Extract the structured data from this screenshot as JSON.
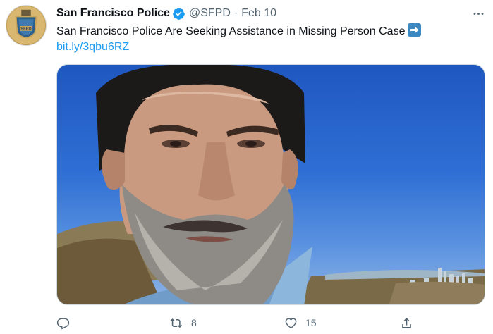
{
  "tweet": {
    "author": {
      "display_name": "San Francisco Police",
      "handle": "@SFPD",
      "verified": true,
      "avatar_icon": "sfpd-badge-avatar"
    },
    "separator": "·",
    "date": "Feb 10",
    "text": "San Francisco Police Are Seeking Assistance in Missing Person Case",
    "emoji": "right-arrow-emoji",
    "link": "bit.ly/3qbu6RZ",
    "media_description_icon": "photo-of-bearded-man"
  },
  "actions": {
    "reply": {
      "icon": "reply-icon",
      "count": ""
    },
    "retweet": {
      "icon": "retweet-icon",
      "count": "8"
    },
    "like": {
      "icon": "heart-icon",
      "count": "15"
    },
    "share": {
      "icon": "share-icon",
      "count": ""
    }
  },
  "more_icon": "more-dots-icon",
  "colors": {
    "link": "#1d9bf0",
    "secondary_text": "#536471",
    "verified_badge": "#1d9bf0",
    "sky": "#2f6fd4"
  }
}
